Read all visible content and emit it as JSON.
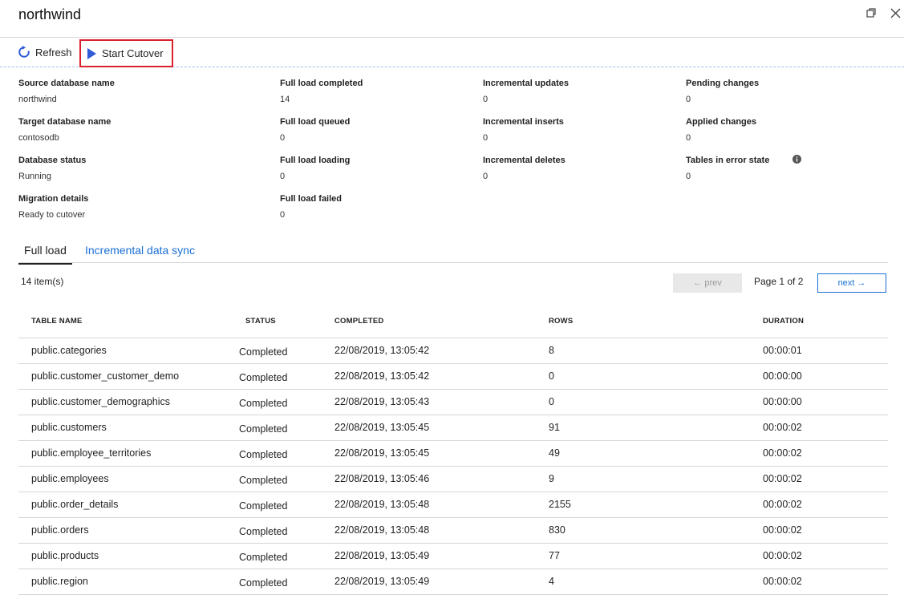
{
  "window": {
    "title": "northwind"
  },
  "toolbar": {
    "refresh_label": "Refresh",
    "cutover_label": "Start Cutover"
  },
  "details": {
    "col1": [
      {
        "label": "Source database name",
        "value": "northwind"
      },
      {
        "label": "Target database name",
        "value": "contosodb"
      },
      {
        "label": "Database status",
        "value": "Running"
      },
      {
        "label": "Migration details",
        "value": "Ready to cutover"
      }
    ],
    "col2": [
      {
        "label": "Full load completed",
        "value": "14"
      },
      {
        "label": "Full load queued",
        "value": "0"
      },
      {
        "label": "Full load loading",
        "value": "0"
      },
      {
        "label": "Full load failed",
        "value": "0"
      }
    ],
    "col3": [
      {
        "label": "Incremental updates",
        "value": "0"
      },
      {
        "label": "Incremental inserts",
        "value": "0"
      },
      {
        "label": "Incremental deletes",
        "value": "0"
      }
    ],
    "col4": [
      {
        "label": "Pending changes",
        "value": "0"
      },
      {
        "label": "Applied changes",
        "value": "0"
      },
      {
        "label": "Tables in error state",
        "value": "0"
      }
    ]
  },
  "tabs": {
    "full_load": "Full load",
    "incremental": "Incremental data sync"
  },
  "pager": {
    "items_count": "14 item(s)",
    "prev": "← prev",
    "page_text": "Page 1 of 2",
    "next": "next →"
  },
  "table": {
    "headers": {
      "name": "TABLE NAME",
      "status": "STATUS",
      "completed": "COMPLETED",
      "rows": "ROWS",
      "duration": "DURATION"
    },
    "rows": [
      {
        "name": "public.categories",
        "status": "Completed",
        "completed": "22/08/2019, 13:05:42",
        "rows": "8",
        "duration": "00:00:01"
      },
      {
        "name": "public.customer_customer_demo",
        "status": "Completed",
        "completed": "22/08/2019, 13:05:42",
        "rows": "0",
        "duration": "00:00:00"
      },
      {
        "name": "public.customer_demographics",
        "status": "Completed",
        "completed": "22/08/2019, 13:05:43",
        "rows": "0",
        "duration": "00:00:00"
      },
      {
        "name": "public.customers",
        "status": "Completed",
        "completed": "22/08/2019, 13:05:45",
        "rows": "91",
        "duration": "00:00:02"
      },
      {
        "name": "public.employee_territories",
        "status": "Completed",
        "completed": "22/08/2019, 13:05:45",
        "rows": "49",
        "duration": "00:00:02"
      },
      {
        "name": "public.employees",
        "status": "Completed",
        "completed": "22/08/2019, 13:05:46",
        "rows": "9",
        "duration": "00:00:02"
      },
      {
        "name": "public.order_details",
        "status": "Completed",
        "completed": "22/08/2019, 13:05:48",
        "rows": "2155",
        "duration": "00:00:02"
      },
      {
        "name": "public.orders",
        "status": "Completed",
        "completed": "22/08/2019, 13:05:48",
        "rows": "830",
        "duration": "00:00:02"
      },
      {
        "name": "public.products",
        "status": "Completed",
        "completed": "22/08/2019, 13:05:49",
        "rows": "77",
        "duration": "00:00:02"
      },
      {
        "name": "public.region",
        "status": "Completed",
        "completed": "22/08/2019, 13:05:49",
        "rows": "4",
        "duration": "00:00:02"
      }
    ]
  },
  "colors": {
    "accent": "#1a6fd6",
    "highlight_border": "#d9202c",
    "play_icon": "#2f5ad8"
  },
  "icons": {
    "refresh": "refresh-icon",
    "play": "play-icon",
    "info": "info-icon",
    "restore": "restore-icon",
    "close": "close-icon"
  }
}
